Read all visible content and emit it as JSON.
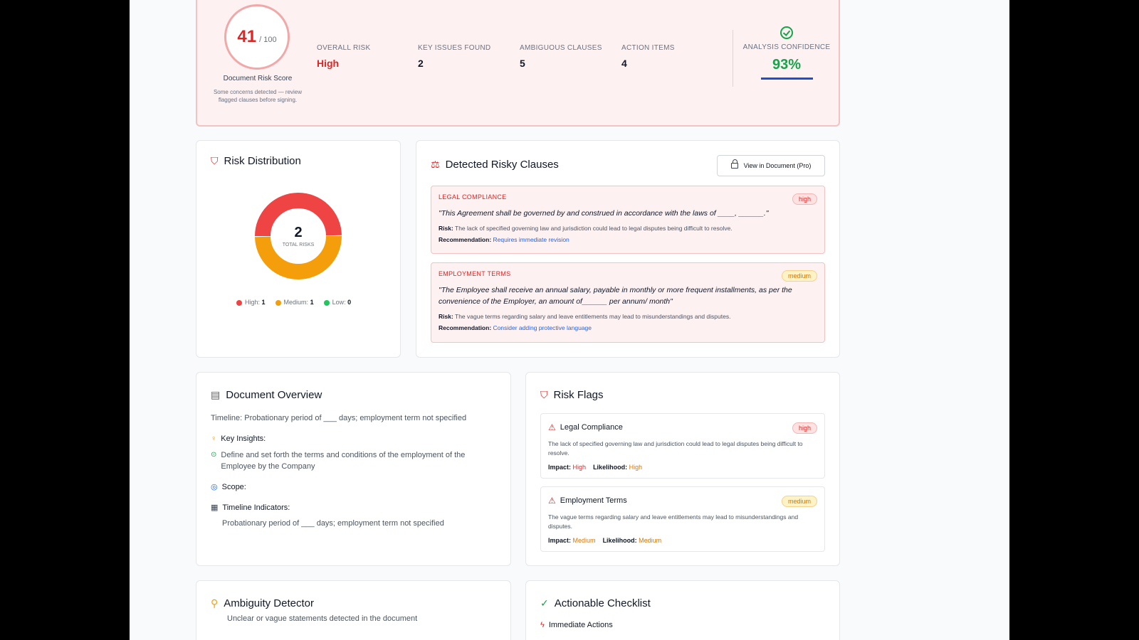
{
  "summary": {
    "score": "41",
    "score_max": "/ 100",
    "score_label": "Document Risk Score",
    "score_note": "Some concerns detected — review flagged clauses before signing.",
    "stats": [
      {
        "label": "OVERALL RISK",
        "value": "High"
      },
      {
        "label": "KEY ISSUES FOUND",
        "value": "2"
      },
      {
        "label": "AMBIGUOUS CLAUSES",
        "value": "5"
      },
      {
        "label": "ACTION ITEMS",
        "value": "4"
      }
    ],
    "confidence_label": "ANALYSIS CONFIDENCE",
    "confidence_value": "93%",
    "confidence_level": 0.93
  },
  "risk_distribution": {
    "title": "Risk Distribution",
    "total": "2",
    "total_label": "TOTAL RISKS",
    "legend": [
      {
        "label": "High:",
        "count": "1",
        "color": "#ef4444",
        "value": 1
      },
      {
        "label": "Medium:",
        "count": "1",
        "color": "#f59e0b",
        "value": 1
      },
      {
        "label": "Low:",
        "count": "0",
        "color": "#22c55e",
        "value": 0
      }
    ]
  },
  "clauses": {
    "title": "Detected Risky Clauses",
    "view_button": "View in Document (Pro)",
    "items": [
      {
        "category": "LEGAL COMPLIANCE",
        "severity": "high",
        "quote": "\"This Agreement shall be governed by and construed in accordance with the laws of ____, ______.\"",
        "risk_label": "Risk:",
        "risk": "The lack of specified governing law and jurisdiction could lead to legal disputes being difficult to resolve.",
        "rec_label": "Recommendation:",
        "rec": "Requires immediate revision"
      },
      {
        "category": "EMPLOYMENT TERMS",
        "severity": "medium",
        "quote": "\"The Employee shall receive an annual salary, payable in monthly or more frequent installments, as per the convenience of the Employer, an amount of______ per annum/ month\"",
        "risk_label": "Risk:",
        "risk": "The vague terms regarding salary and leave entitlements may lead to misunderstandings and disputes.",
        "rec_label": "Recommendation:",
        "rec": "Consider adding protective language"
      }
    ]
  },
  "overview": {
    "title": "Document Overview",
    "timeline": "Timeline: Probationary period of ___ days; employment term not specified",
    "insights_label": "Key Insights:",
    "insight": "Define and set forth the terms and conditions of the employment of the Employee by the Company",
    "scope_label": "Scope:",
    "timeline_label": "Timeline Indicators:",
    "timeline_detail": "Probationary period of ___ days; employment term not specified"
  },
  "flags": {
    "title": "Risk Flags",
    "items": [
      {
        "title": "Legal Compliance",
        "severity": "high",
        "desc": "The lack of specified governing law and jurisdiction could lead to legal disputes being difficult to resolve.",
        "impact_label": "Impact:",
        "impact": "High",
        "likelihood_label": "Likelihood:",
        "likelihood": "High"
      },
      {
        "title": "Employment Terms",
        "severity": "medium",
        "desc": "The vague terms regarding salary and leave entitlements may lead to misunderstandings and disputes.",
        "impact_label": "Impact:",
        "impact": "Medium",
        "likelihood_label": "Likelihood:",
        "likelihood": "Medium"
      }
    ]
  },
  "ambiguity": {
    "title": "Ambiguity Detector",
    "subtitle": "Unclear or vague statements detected in the document"
  },
  "checklist": {
    "title": "Actionable Checklist",
    "section": "Immediate Actions"
  }
}
